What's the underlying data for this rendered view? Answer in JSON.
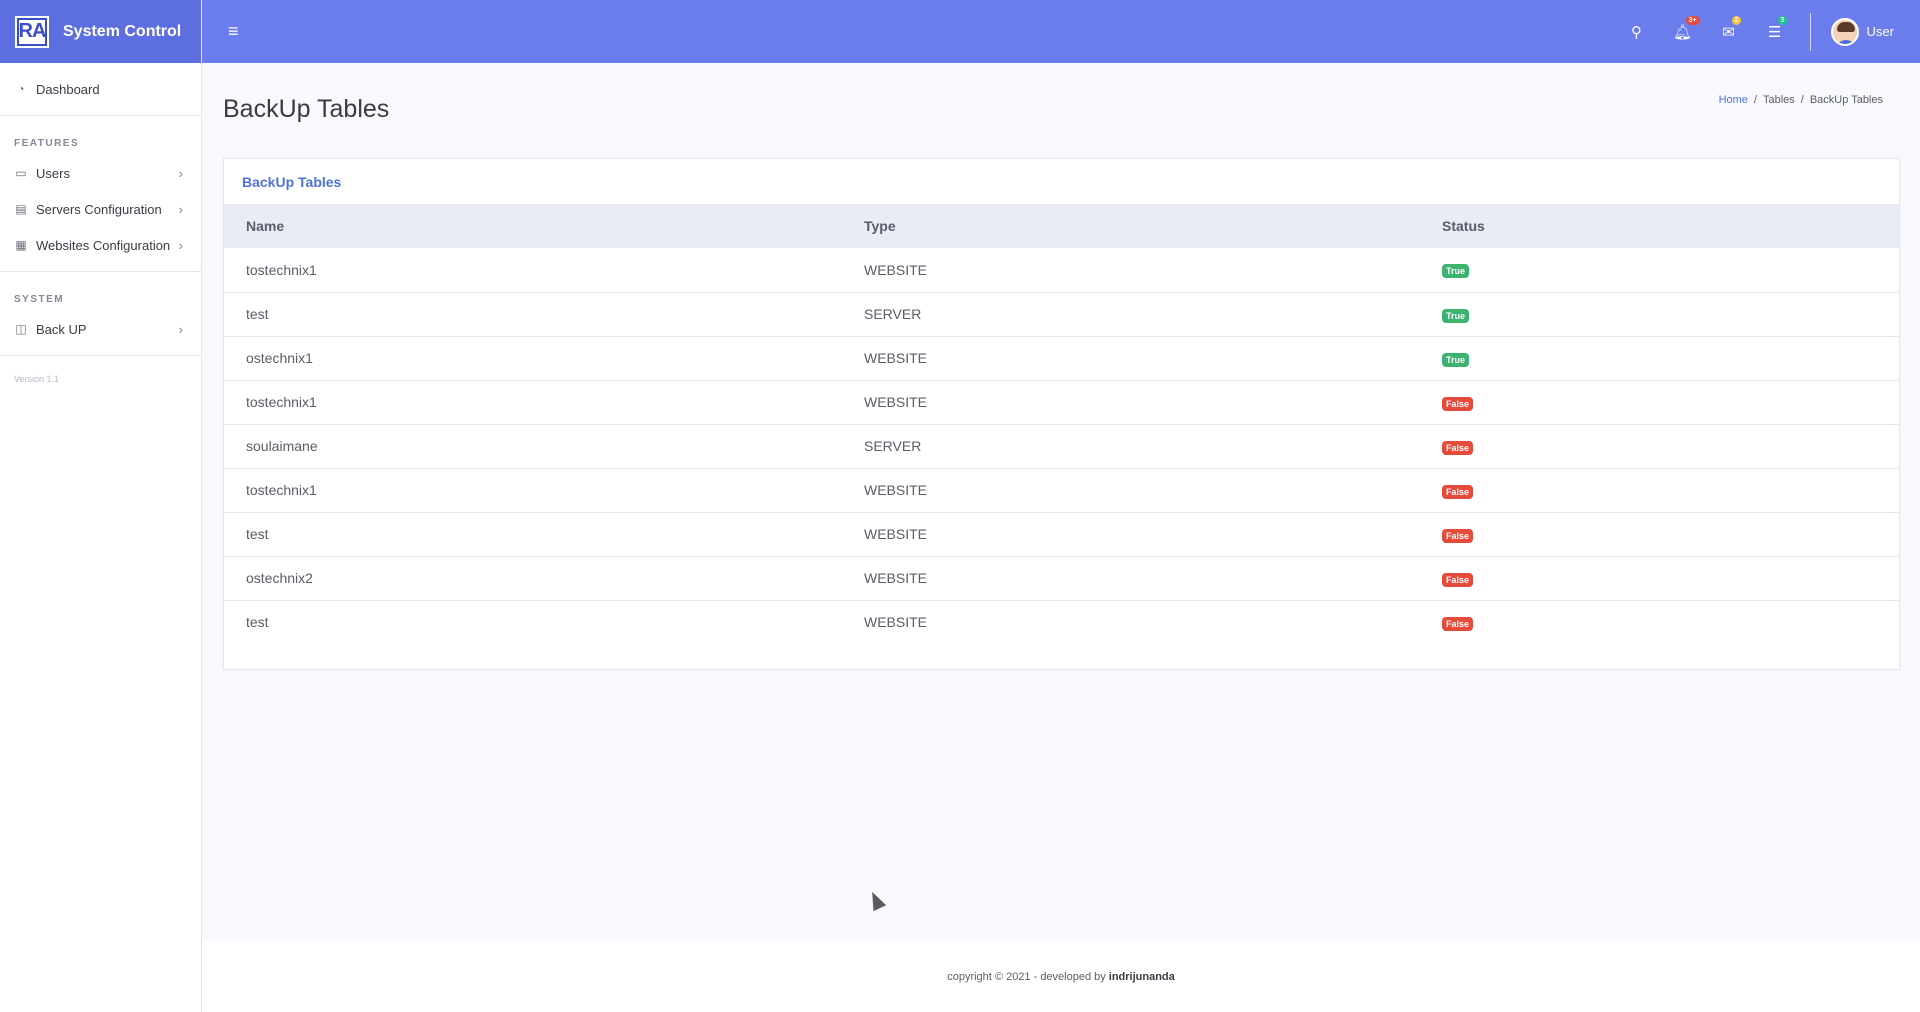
{
  "sidebar": {
    "brand_logo": "RA",
    "brand_title": "System Control",
    "dashboard": "Dashboard",
    "features_heading": "FEATURES",
    "items": [
      {
        "label": "Users",
        "icon": "window-icon"
      },
      {
        "label": "Servers Configuration",
        "icon": "server-icon"
      },
      {
        "label": "Websites Configuration",
        "icon": "table-icon"
      }
    ],
    "system_heading": "SYSTEM",
    "backup_label": "Back UP",
    "version": "Version 1.1"
  },
  "topbar": {
    "alerts_badge": "3+",
    "messages_badge": "2",
    "tasks_badge": "3",
    "user_label": "User"
  },
  "page": {
    "title": "BackUp Tables",
    "breadcrumb": [
      "Home",
      "Tables",
      "BackUp Tables"
    ]
  },
  "card": {
    "title": "BackUp Tables",
    "columns": [
      "Name",
      "Type",
      "Status"
    ],
    "rows": [
      {
        "name": "tostechnix1",
        "type": "WEBSITE",
        "status": "True"
      },
      {
        "name": "test",
        "type": "SERVER",
        "status": "True"
      },
      {
        "name": "ostechnix1",
        "type": "WEBSITE",
        "status": "True"
      },
      {
        "name": "tostechnix1",
        "type": "WEBSITE",
        "status": "False"
      },
      {
        "name": "soulaimane",
        "type": "SERVER",
        "status": "False"
      },
      {
        "name": "tostechnix1",
        "type": "WEBSITE",
        "status": "False"
      },
      {
        "name": "test",
        "type": "WEBSITE",
        "status": "False"
      },
      {
        "name": "ostechnix2",
        "type": "WEBSITE",
        "status": "False"
      },
      {
        "name": "test",
        "type": "WEBSITE",
        "status": "False"
      }
    ]
  },
  "footer": {
    "text": "copyright © 2021 - developed by",
    "author": "indrijunanda"
  },
  "colors": {
    "topbar": "#6b7ded",
    "brand": "#5d6fe0",
    "true_badge": "#3cb371",
    "false_badge": "#e74a3b",
    "alerts_badge": "#e74a3b",
    "messages_badge": "#f6c23e",
    "tasks_badge": "#1cc88a"
  }
}
